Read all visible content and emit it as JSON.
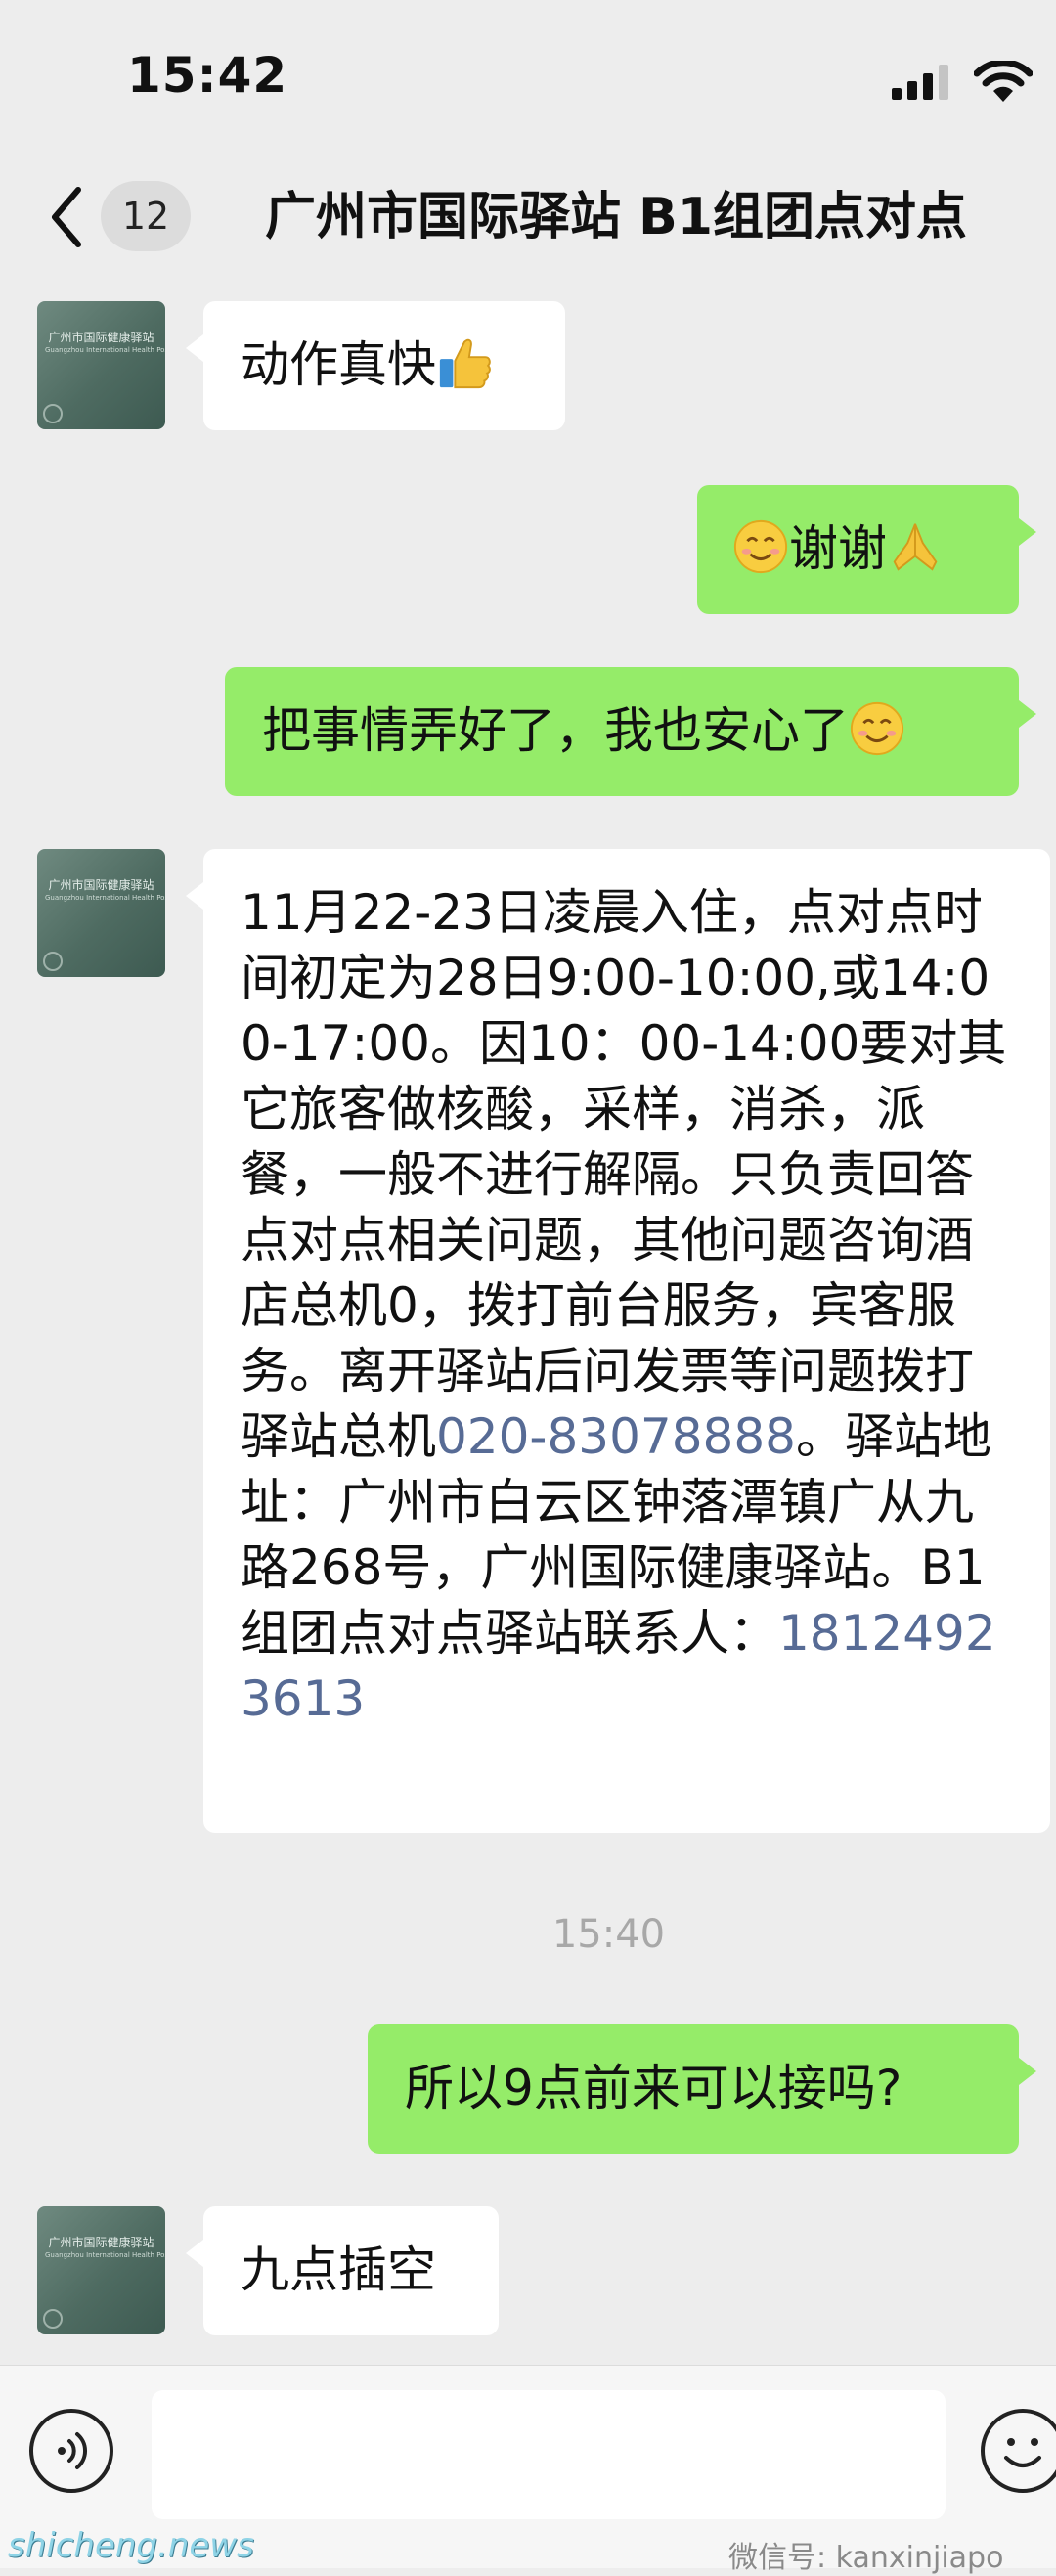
{
  "status_bar": {
    "time": "15:42"
  },
  "header": {
    "back_icon": "chevron-left-icon",
    "unread_count": "12",
    "title": "广州市国际驿站 B1组团点对点"
  },
  "avatar": {
    "line1": "广州市国际健康驿站",
    "line2": "Guangzhou International Health Post"
  },
  "messages": {
    "m1": {
      "sender": "other",
      "text": "动作真快",
      "emoji": "thumbs-up-icon"
    },
    "m2": {
      "sender": "me",
      "emoji_before": "smiling-face-icon",
      "text": "谢谢",
      "emoji_after": "folded-hands-icon"
    },
    "m3": {
      "sender": "me",
      "text": "把事情弄好了，我也安心了",
      "emoji": "smiling-face-icon"
    },
    "m4": {
      "sender": "other",
      "text_part1": "11月22-23日凌晨入住，点对点时间初定为28日9:00-10:00,或14:00-17:00。因10：00-14:00要对其它旅客做核酸，采样，消杀，派餐，一般不进行解隔。只负责回答点对点相关问题，其他问题咨询酒店总机0，拨打前台服务，宾客服务。离开驿站后问发票等问题拨打驿站总机",
      "phone1": "020-83078888",
      "text_part2": "。驿站地址：广州市白云区钟落潭镇广从九路268号，广州国际健康驿站。B1组团点对点驿站联系人：",
      "phone2": "18124923613"
    },
    "timestamp": "15:40",
    "m5": {
      "sender": "me",
      "text": "所以9点前来可以接吗?"
    },
    "m6": {
      "sender": "other",
      "text": "九点插空"
    }
  },
  "input_bar": {
    "voice_icon": "voice-icon",
    "text_value": "",
    "emoji_icon": "emoji-face-icon"
  },
  "watermarks": {
    "wechat": "微信号: kanxinjiapo",
    "site": "shicheng.news"
  }
}
